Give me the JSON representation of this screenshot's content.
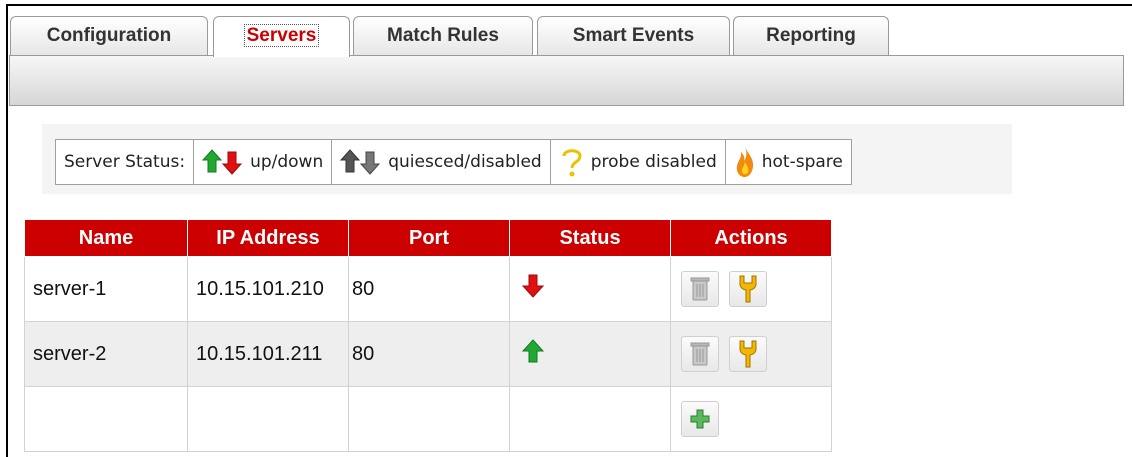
{
  "tabs": [
    {
      "label": "Configuration",
      "active": false
    },
    {
      "label": "Servers",
      "active": true
    },
    {
      "label": "Match Rules",
      "active": false
    },
    {
      "label": "Smart Events",
      "active": false
    },
    {
      "label": "Reporting",
      "active": false
    }
  ],
  "legend": {
    "title": "Server Status:",
    "items": [
      {
        "label": "up/down",
        "icon": "up-down-arrows-icon"
      },
      {
        "label": "quiesced/disabled",
        "icon": "gray-arrows-icon"
      },
      {
        "label": "probe disabled",
        "icon": "question-mark-icon"
      },
      {
        "label": "hot-spare",
        "icon": "flame-icon"
      }
    ]
  },
  "table": {
    "columns": [
      "Name",
      "IP Address",
      "Port",
      "Status",
      "Actions"
    ],
    "rows": [
      {
        "name": "server-1",
        "ip": "10.15.101.210",
        "port": "80",
        "status": "down"
      },
      {
        "name": "server-2",
        "ip": "10.15.101.211",
        "port": "80",
        "status": "up"
      }
    ]
  },
  "colors": {
    "header_red": "#cc0000",
    "status_down": "#e01010",
    "status_up": "#22a832",
    "active_tab_text": "#cc0000"
  }
}
